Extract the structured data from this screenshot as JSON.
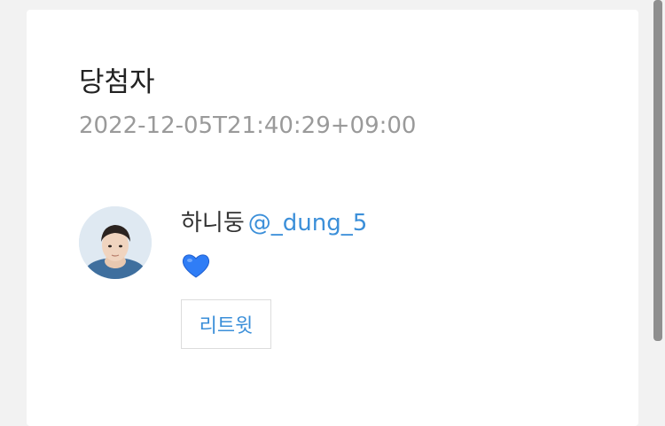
{
  "page": {
    "title": "당첨자",
    "timestamp": "2022-12-05T21:40:29+09:00"
  },
  "winner": {
    "name": "하니둥",
    "handle": "@_dung_5",
    "tweet_emoji_icon": "blue-heart-icon",
    "avatar_icon": "profile-photo"
  },
  "actions": {
    "retweet_label": "리트윗"
  },
  "colors": {
    "link": "#3b8fd9",
    "heart": "#2f7df6",
    "timestamp": "#9a9a9a",
    "background": "#f2f2f2"
  }
}
